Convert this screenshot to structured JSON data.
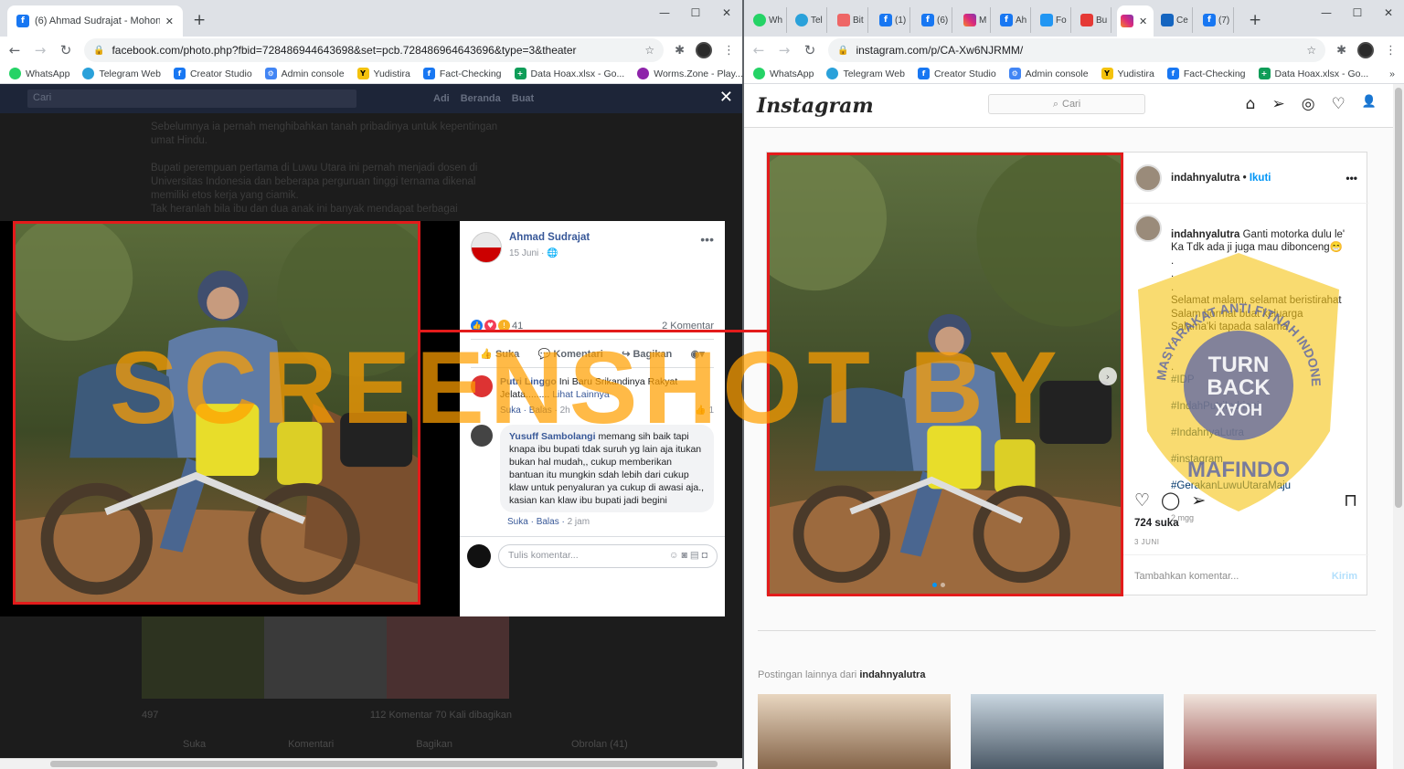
{
  "left_browser": {
    "tab_title": "(6) Ahmad Sudrajat - Mohon Do",
    "url": "facebook.com/photo.php?fbid=728486944643698&set=pcb.728486964643696&type=3&theater",
    "bookmarks": [
      "WhatsApp",
      "Telegram Web",
      "Creator Studio",
      "Admin console",
      "Yudistira",
      "Fact-Checking",
      "Data Hoax.xlsx - Go...",
      "Worms.Zone - Play..."
    ]
  },
  "right_browser": {
    "tabs": [
      "Wh",
      "Tel",
      "Bit",
      "(1)",
      "(6)",
      "M",
      "Ah",
      "Fo",
      "Bu",
      "",
      "Ce",
      "(7)"
    ],
    "url": "instagram.com/p/CA-Xw6NJRMM/",
    "bookmarks": [
      "WhatsApp",
      "Telegram Web",
      "Creator Studio",
      "Admin console",
      "Yudistira",
      "Fact-Checking",
      "Data Hoax.xlsx - Go..."
    ]
  },
  "facebook": {
    "search_placeholder": "Cari",
    "topnav": [
      "Adi",
      "Beranda",
      "Buat"
    ],
    "bg_text": [
      "Sebelumnya ia pernah menghibahkan tanah pribadinya untuk kepentingan umat Hindu.",
      "Bupati perempuan pertama di Luwu Utara ini pernah menjadi dosen di Universitas Indonesia dan beberapa perguruan tinggi ternama dikenal memiliki etos kerja yang ciamik.",
      "Tak heranlah bila ibu dan dua anak ini banyak mendapat berbagai"
    ],
    "author": "Ahmad Sudrajat",
    "date": "15 Juni",
    "reaction_count": "41",
    "comment_count": "2 Komentar",
    "actions": [
      "Suka",
      "Komentari",
      "Bagikan"
    ],
    "comments": [
      {
        "name": "Putri Linggo",
        "text": "Ini Baru Srikandinya Rakyat Jelata.........",
        "more": "Lihat Lainnya",
        "like": "Suka",
        "reply": "Balas",
        "time": "2h",
        "likes": "1"
      },
      {
        "name": "Yusuff Sambolangi",
        "text": "memang sih baik tapi knapa ibu bupati tdak suruh yg lain aja itukan bukan hal mudah,, cukup memberikan bantuan itu mungkin sdah lebih dari cukup klaw untuk penyaluran ya cukup di awasi aja., kasian kan klaw ibu bupati jadi begini",
        "like": "Suka",
        "reply": "Balas",
        "time": "2 jam"
      }
    ],
    "comment_placeholder": "Tulis komentar...",
    "bottom_counts_left": "497",
    "bottom_counts_right": "112 Komentar  70 Kali dibagikan",
    "footer_actions": [
      "Suka",
      "Komentari",
      "Bagikan"
    ],
    "chat": "Obrolan (41)"
  },
  "watermark": "SCREENSHOT BY",
  "instagram": {
    "search_placeholder": "Cari",
    "username": "indahnyalutra",
    "follow": "Ikuti",
    "caption": "Ganti motorka dulu le'\nKa Tdk ada ji juga mau dibonceng😁\n.\n.\n.\nSelamat malam, selamat beristirahat\nSalam hormat buat keluarga\nSalama'ki tapada salama'\n.\n.\n.",
    "hashtags": [
      "#IDP",
      "#IndahPutriIndriani",
      "#IndahnyaLutra",
      "#instagram",
      "#GerakanLuwuUtaraMaju"
    ],
    "time_ago": "2 mgg",
    "likes": "724 suka",
    "date": "3 JUNI",
    "comment_placeholder": "Tambahkan komentar...",
    "send": "Kirim",
    "more_posts_prefix": "Postingan lainnya dari",
    "more_posts_user": "indahnyalutra"
  },
  "badge": {
    "ring_text": "MASYARAKAT ANTI FITNAH INDONESIA",
    "center_line1": "TURN",
    "center_line2": "BACK",
    "center_line3": "HOAX",
    "bottom": "MAFINDO",
    "color": "#f5c518"
  }
}
